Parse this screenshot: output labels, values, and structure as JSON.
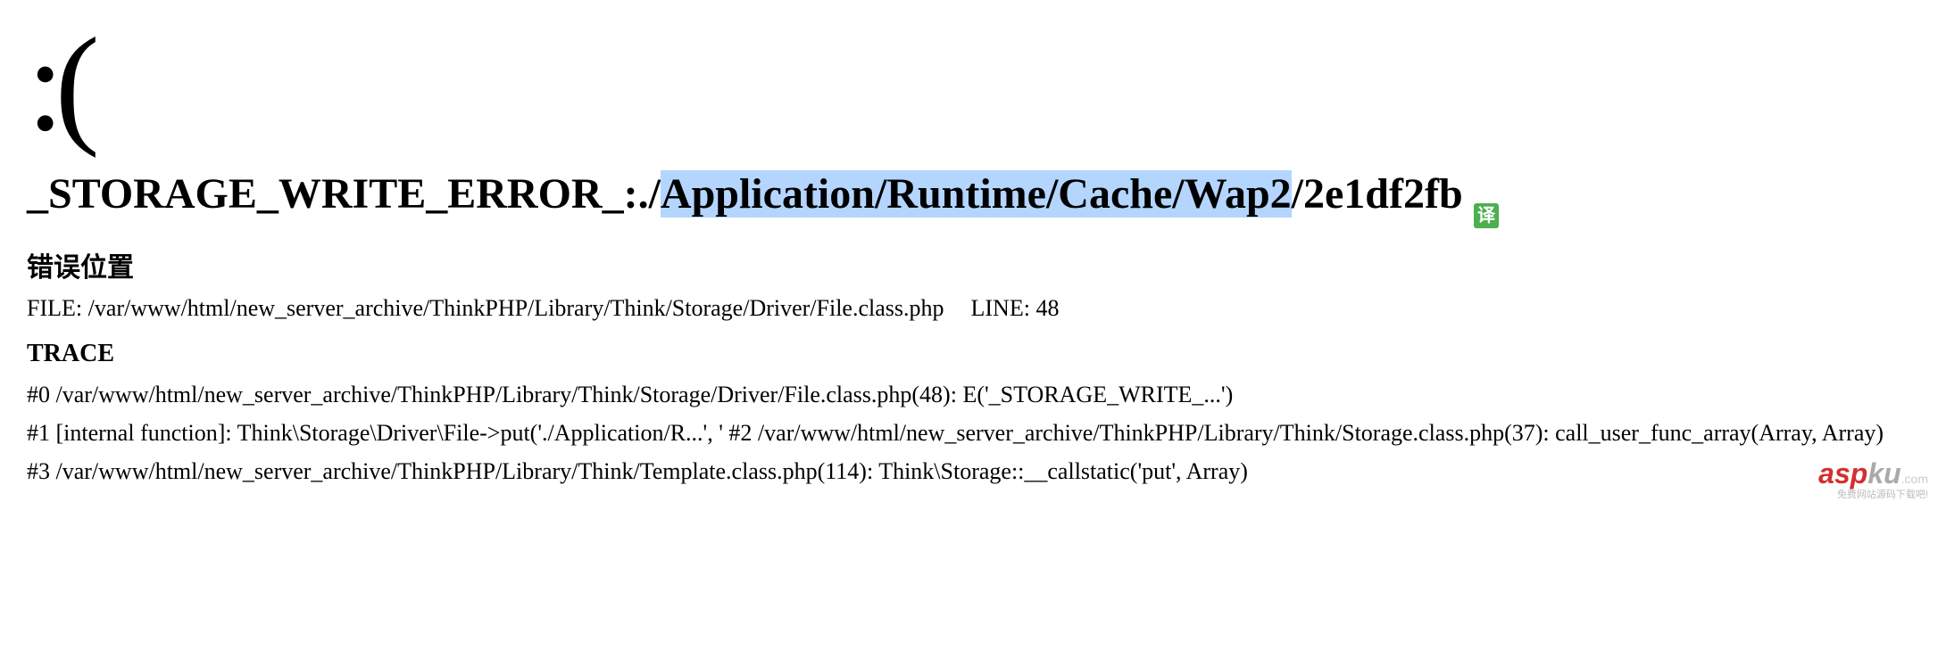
{
  "sad_face": ":(",
  "error": {
    "prefix": "_STORAGE_WRITE_ERROR_:./",
    "highlighted": "Application/Runtime/Cache/Wap2",
    "suffix": "/2e1df2fb"
  },
  "location": {
    "heading": "错误位置",
    "file_label": "FILE: ",
    "file_path": "/var/www/html/new_server_archive/ThinkPHP/Library/Think/Storage/Driver/File.class.php",
    "line_label": "LINE: ",
    "line_number": "48"
  },
  "trace": {
    "heading": "TRACE",
    "lines": [
      "#0 /var/www/html/new_server_archive/ThinkPHP/Library/Think/Storage/Driver/File.class.php(48): E('_STORAGE_WRITE_...')",
      "#1 [internal function]: Think\\Storage\\Driver\\File->put('./Application/R...', ' #2 /var/www/html/new_server_archive/ThinkPHP/Library/Think/Storage.class.php(37): call_user_func_array(Array, Array)",
      "#3 /var/www/html/new_server_archive/ThinkPHP/Library/Think/Template.class.php(114): Think\\Storage::__callstatic('put', Array)"
    ]
  },
  "translate_badge": "译",
  "watermark": {
    "brand_red": "asp",
    "brand_gray": "ku",
    "brand_suffix": ".com",
    "tagline": "免费网站源码下载吧!"
  }
}
